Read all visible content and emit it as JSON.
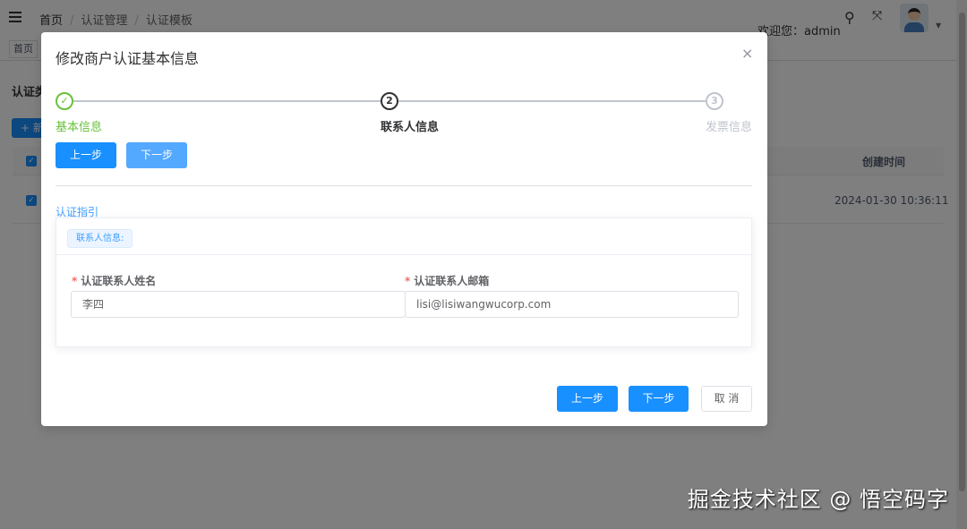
{
  "header": {
    "breadcrumb": [
      "首页",
      "认证管理",
      "认证模板"
    ],
    "welcome": "欢迎您：admin"
  },
  "tabs": [
    "首页"
  ],
  "page": {
    "section_title": "认证类",
    "add_button": "+ 新",
    "table": {
      "time_header": "创建时间",
      "rows": [
        {
          "created": "2024-01-30 10:36:11"
        }
      ]
    }
  },
  "modal": {
    "title": "修改商户认证基本信息",
    "close": "×",
    "steps": [
      {
        "index": "✓",
        "label": "基本信息",
        "status": "finished"
      },
      {
        "index": "2",
        "label": "联系人信息",
        "status": "active"
      },
      {
        "index": "3",
        "label": "发票信息",
        "status": "pending"
      }
    ],
    "prev_label": "上一步",
    "next_label": "下一步",
    "guide_label": "认证指引",
    "card_tag": "联系人信息:",
    "fields": [
      {
        "label": "认证联系人姓名",
        "value": "李四"
      },
      {
        "label": "认证联系人邮箱",
        "value": "lisi@lisiwangwucorp.com"
      }
    ],
    "footer": {
      "prev": "上一步",
      "next": "下一步",
      "cancel": "取 消"
    }
  },
  "watermark": "掘金技术社区 @ 悟空码字",
  "colors": {
    "primary": "#1890ff",
    "success": "#67c23a"
  }
}
